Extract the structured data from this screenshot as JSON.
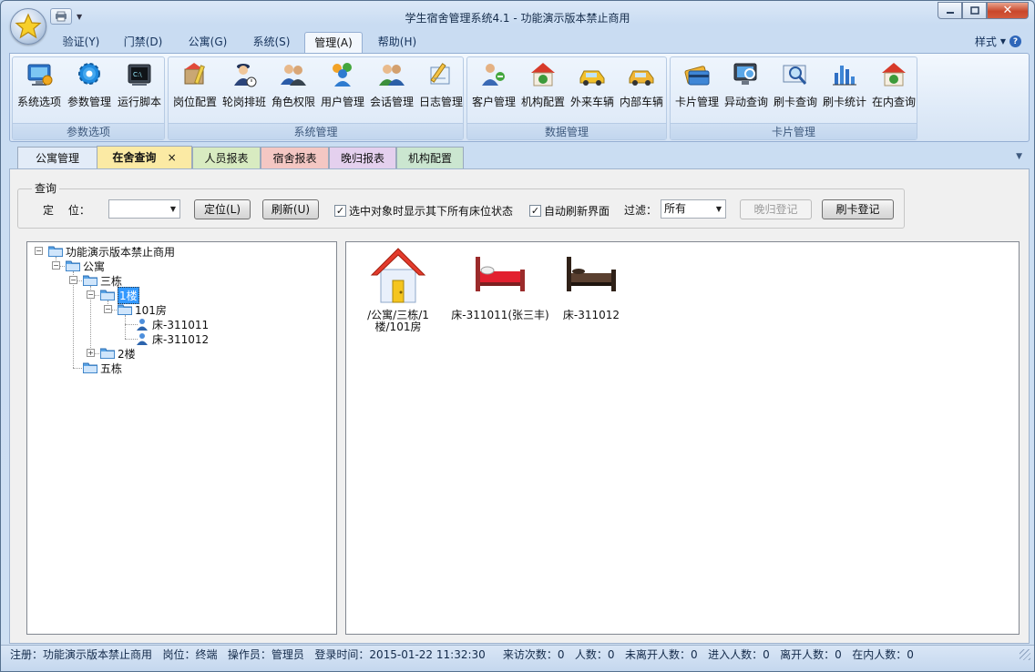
{
  "window": {
    "title": "学生宿舍管理系统4.1 - 功能演示版本禁止商用",
    "quick_access": [
      "save-icon",
      "dropdown-icon"
    ],
    "controls": [
      "minimize",
      "maximize",
      "close"
    ]
  },
  "menu": {
    "tabs": [
      "验证(Y)",
      "门禁(D)",
      "公寓(G)",
      "系统(S)",
      "管理(A)",
      "帮助(H)"
    ],
    "active": "管理(A)",
    "style_label": "样式",
    "help_icon": "help-icon"
  },
  "ribbon": {
    "groups": [
      {
        "label": "参数选项",
        "buttons": [
          {
            "label": "系统选项",
            "icon": "system-options-icon"
          },
          {
            "label": "参数管理",
            "icon": "gear-icon"
          },
          {
            "label": "运行脚本",
            "icon": "script-icon"
          }
        ]
      },
      {
        "label": "系统管理",
        "buttons": [
          {
            "label": "岗位配置",
            "icon": "post-config-icon"
          },
          {
            "label": "轮岗排班",
            "icon": "guard-schedule-icon"
          },
          {
            "label": "角色权限",
            "icon": "role-permission-icon"
          },
          {
            "label": "用户管理",
            "icon": "users-icon"
          },
          {
            "label": "会话管理",
            "icon": "session-icon"
          },
          {
            "label": "日志管理",
            "icon": "log-icon"
          }
        ]
      },
      {
        "label": "数据管理",
        "buttons": [
          {
            "label": "客户管理",
            "icon": "customer-icon"
          },
          {
            "label": "机构配置",
            "icon": "org-config-icon"
          },
          {
            "label": "外来车辆",
            "icon": "external-car-icon"
          },
          {
            "label": "内部车辆",
            "icon": "internal-car-icon"
          }
        ]
      },
      {
        "label": "卡片管理",
        "buttons": [
          {
            "label": "卡片管理",
            "icon": "card-icon"
          },
          {
            "label": "异动查询",
            "icon": "monitor-search-icon"
          },
          {
            "label": "刷卡查询",
            "icon": "swipe-search-icon"
          },
          {
            "label": "刷卡统计",
            "icon": "statistics-icon"
          },
          {
            "label": "在内查询",
            "icon": "home-search-icon"
          }
        ]
      }
    ]
  },
  "doc_tabs": [
    {
      "label": "公寓管理",
      "color": "#e3ecf8"
    },
    {
      "label": "在舍查询",
      "color": "#fbeaa4",
      "active": true,
      "close": "×"
    },
    {
      "label": "人员报表",
      "color": "#d8ebc1"
    },
    {
      "label": "宿舍报表",
      "color": "#f4c7c3"
    },
    {
      "label": "晚归报表",
      "color": "#e4d0ee"
    },
    {
      "label": "机构配置",
      "color": "#cbe6d0"
    }
  ],
  "doc_tabs_menu_icon": "tab-list-dropdown-icon",
  "query": {
    "group_title": "查询",
    "locate_label": "定　 位：",
    "locate_value": "",
    "locate_button": "定位(L)",
    "refresh_button": "刷新(U)",
    "show_beds_checkbox": {
      "label": "选中对象时显示其下所有床位状态",
      "checked": true
    },
    "auto_refresh_checkbox": {
      "label": "自动刷新界面",
      "checked": true
    },
    "filter_label": "过滤：",
    "filter_value": "所有",
    "late_button": "晚归登记",
    "swipe_button": "刷卡登记"
  },
  "tree": [
    {
      "label": "功能演示版本禁止商用",
      "level": 0,
      "expanded": true,
      "type": "folder"
    },
    {
      "label": "公寓",
      "level": 1,
      "expanded": true,
      "type": "folder"
    },
    {
      "label": "三栋",
      "level": 2,
      "expanded": true,
      "type": "folder"
    },
    {
      "label": "1楼",
      "level": 3,
      "expanded": true,
      "type": "folder",
      "selected": true
    },
    {
      "label": "101房",
      "level": 4,
      "expanded": true,
      "type": "folder"
    },
    {
      "label": "床-311011",
      "level": 5,
      "type": "person"
    },
    {
      "label": "床-311012",
      "level": 5,
      "type": "person"
    },
    {
      "label": "2楼",
      "level": 3,
      "expanded": false,
      "type": "folder"
    },
    {
      "label": "五栋",
      "level": 2,
      "type": "folder"
    }
  ],
  "view_items": [
    {
      "label": "/公寓/三栋/1楼/101房",
      "icon": "house-icon"
    },
    {
      "label": "床-311011(张三丰)",
      "icon": "occupied-bed-icon"
    },
    {
      "label": "床-311012",
      "icon": "empty-bed-icon"
    }
  ],
  "status": {
    "text": "注册：功能演示版本禁止商用   岗位：终端   操作员：管理员   登录时间：2015-01-22 11:32:30     来访次数：0   人数：0   未离开人数：0   进入人数：0   离开人数：0   在内人数：0"
  }
}
